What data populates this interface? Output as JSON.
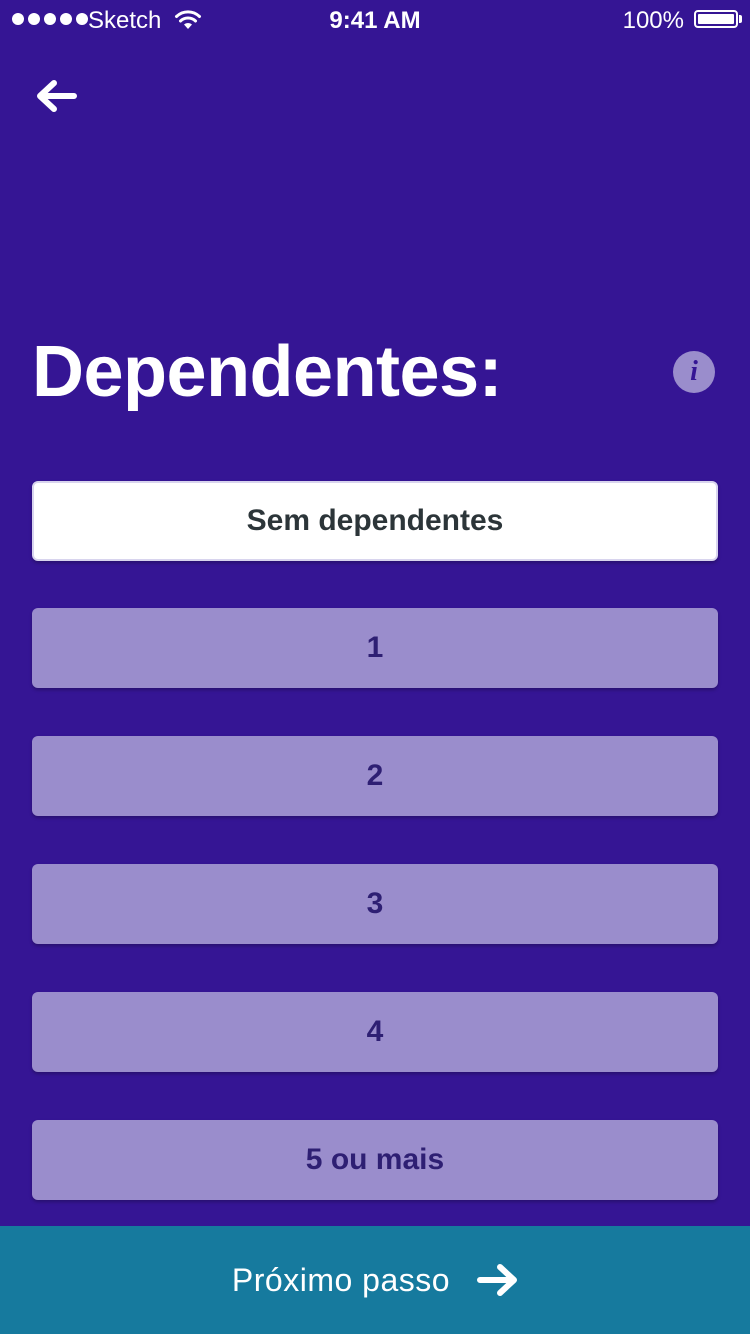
{
  "status_bar": {
    "carrier": "Sketch",
    "time": "9:41 AM",
    "battery_percent": "100%",
    "battery_level": 1.0,
    "signal_bars": 5
  },
  "nav": {
    "back_icon": "arrow-left-icon"
  },
  "header": {
    "title": "Dependentes:",
    "info_icon": "info-icon",
    "info_glyph": "i"
  },
  "options": [
    {
      "label": "Sem dependentes",
      "selected": true
    },
    {
      "label": "1",
      "selected": false
    },
    {
      "label": "2",
      "selected": false
    },
    {
      "label": "3",
      "selected": false
    },
    {
      "label": "4",
      "selected": false
    },
    {
      "label": "5 ou mais",
      "selected": false
    }
  ],
  "footer": {
    "next_label": "Próximo passo",
    "next_icon": "arrow-right-icon"
  },
  "colors": {
    "background": "#351594",
    "option_default": "#9a8dcc",
    "option_selected": "#ffffff",
    "footer": "#167a9e"
  }
}
